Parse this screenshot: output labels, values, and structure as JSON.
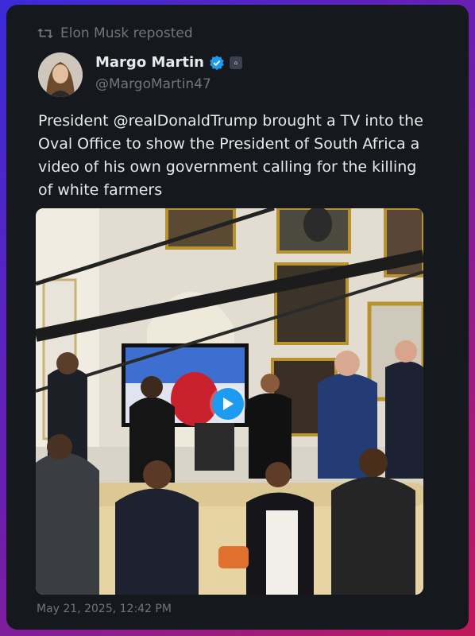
{
  "repost": {
    "label": "Elon Musk reposted",
    "icon": "repost-icon"
  },
  "author": {
    "name": "Margo Martin",
    "handle": "@MargoMartin47",
    "verified_icon": "verified-badge-icon",
    "verified_color": "#1d9bf0"
  },
  "post": {
    "text": "President @realDonaldTrump brought a TV into the Oval Office to show the President of South Africa a video of his own government calling for the killing of white farmers",
    "timestamp": "May 21, 2025, 12:42 PM"
  },
  "media": {
    "type": "video",
    "play_icon": "play-icon",
    "accent": "#1d9bf0"
  },
  "colors": {
    "card_bg": "#15181c",
    "text": "#e7e9ea",
    "muted": "#71767b"
  }
}
